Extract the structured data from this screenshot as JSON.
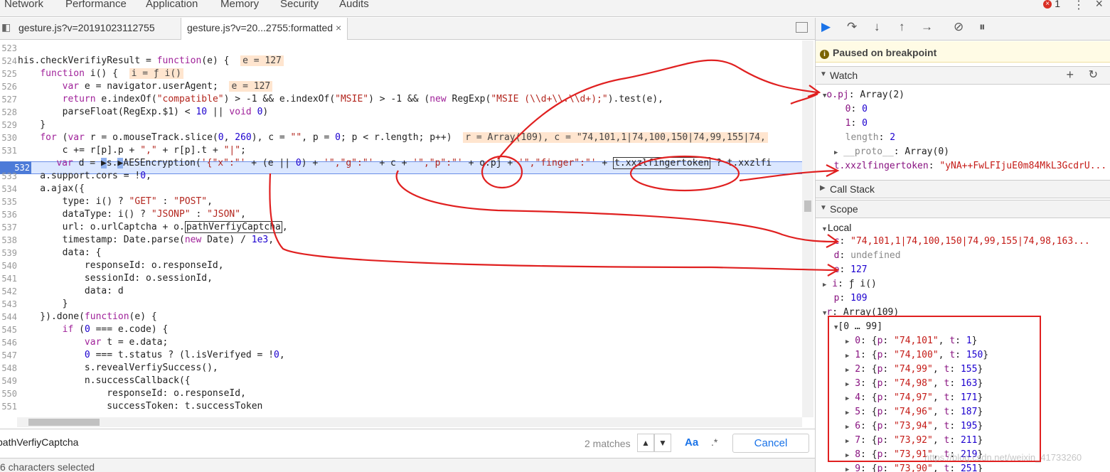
{
  "top_tabs": [
    "Network",
    "Performance",
    "Application",
    "Memory",
    "Security",
    "Audits"
  ],
  "error_count": "1",
  "file_tabs": [
    "gesture.js?v=20191023112755",
    "gesture.js?v=20...2755:formatted"
  ],
  "code_lines": [
    {
      "n": "523",
      "html": ""
    },
    {
      "n": "524",
      "html": "<span>his.checkVerifiyResult = </span><span class=\"kw\">function</span><span>(e) {  </span><span class=\"val\">e = 127</span>"
    },
    {
      "n": "525",
      "html": "<span>    </span><span class=\"kw\">function</span><span> i() {  </span><span class=\"val\">i = ƒ i()</span>"
    },
    {
      "n": "526",
      "html": "<span>        </span><span class=\"kw\">var</span><span> e = navigator.userAgent;  </span><span class=\"val\">e = 127</span>"
    },
    {
      "n": "527",
      "html": "<span>        </span><span class=\"kw\">return</span><span> e.indexOf(</span><span class=\"str\">\"compatible\"</span><span>) &gt; -1 &amp;&amp; e.indexOf(</span><span class=\"str\">\"MSIE\"</span><span>) &gt; -1 &amp;&amp; (</span><span class=\"kw\">new</span><span> RegExp(</span><span class=\"str\">\"MSIE (\\\\d+\\\\.\\\\d+);\"</span><span>).test(e),</span>"
    },
    {
      "n": "528",
      "html": "<span>        parseFloat(RegExp.$1) &lt; </span><span class=\"num\">10</span><span> || </span><span class=\"kw\">void</span><span> </span><span class=\"num\">0</span><span>)</span>"
    },
    {
      "n": "529",
      "html": "<span>    }</span>"
    },
    {
      "n": "530",
      "html": "<span>    </span><span class=\"kw\">for</span><span> (</span><span class=\"kw\">var</span><span> r = o.mouseTrack.slice(</span><span class=\"num\">0</span><span>, </span><span class=\"num\">260</span><span>), c = </span><span class=\"str\">\"\"</span><span>, p = </span><span class=\"num\">0</span><span>; p &lt; r.length; p++)  </span><span class=\"val\">r = Array(109), c = \"74,101,1|74,100,150|74,99,155|74,</span>"
    },
    {
      "n": "531",
      "html": "<span>        c += r[p].p + </span><span class=\"str\">\",\"</span><span> + r[p].t + </span><span class=\"str\">\"|\"</span><span>;</span>"
    },
    {
      "n": "532",
      "html": "<span>    </span><span class=\"kw\">var</span><span> d = </span><span style=\"background:#8fb0ee\">&#x25b6;</span><span>s.</span><span style=\"background:#8fb0ee\">&#x25b6;</span><span>AESEncryption(</span><span class=\"str\">'{\"x\":\"'</span><span> + (e || </span><span class=\"num\">0</span><span>) + </span><span class=\"str\">'\",\"g\":\"'</span><span> + c + </span><span class=\"str\">'\",\"p\":\"'</span><span> + o.pj + </span><span class=\"str\">'\",\"finger\":\"'</span><span> + </span><span class=\"hlbox\">t.xxzlfingertoken</span><span> ? t.xxzlfi</span>"
    },
    {
      "n": "533",
      "html": "<span>    a.support.cors = !</span><span class=\"num\">0</span><span>,</span>"
    },
    {
      "n": "534",
      "html": "<span>    a.ajax({</span>"
    },
    {
      "n": "535",
      "html": "<span>        type: i() ? </span><span class=\"str\">\"GET\"</span><span> : </span><span class=\"str\">\"POST\"</span><span>,</span>"
    },
    {
      "n": "536",
      "html": "<span>        dataType: i() ? </span><span class=\"str\">\"JSONP\"</span><span> : </span><span class=\"str\">\"JSON\"</span><span>,</span>"
    },
    {
      "n": "537",
      "html": "<span>        url: o.urlCaptcha + o.</span><span class=\"hlbox\">pathVerfiyCaptcha</span><span>,</span>"
    },
    {
      "n": "538",
      "html": "<span>        timestamp: Date.parse(</span><span class=\"kw\">new</span><span> Date) / </span><span class=\"num\">1e3</span><span>,</span>"
    },
    {
      "n": "539",
      "html": "<span>        data: {</span>"
    },
    {
      "n": "540",
      "html": "<span>            responseId: o.responseId,</span>"
    },
    {
      "n": "541",
      "html": "<span>            sessionId: o.sessionId,</span>"
    },
    {
      "n": "542",
      "html": "<span>            data: d</span>"
    },
    {
      "n": "543",
      "html": "<span>        }</span>"
    },
    {
      "n": "544",
      "html": "<span>    }).done(</span><span class=\"kw\">function</span><span>(e) {</span>"
    },
    {
      "n": "545",
      "html": "<span>        </span><span class=\"kw\">if</span><span> (</span><span class=\"num\">0</span><span> === e.code) {</span>"
    },
    {
      "n": "546",
      "html": "<span>            </span><span class=\"kw\">var</span><span> t = e.data;</span>"
    },
    {
      "n": "547",
      "html": "<span>            </span><span class=\"num\">0</span><span> === t.status ? (l.isVerifyed = !</span><span class=\"num\">0</span><span>,</span>"
    },
    {
      "n": "548",
      "html": "<span>            s.revealVerfiySuccess(),</span>"
    },
    {
      "n": "549",
      "html": "<span>            n.successCallback({</span>"
    },
    {
      "n": "550",
      "html": "<span>                responseId: o.responseId,</span>"
    },
    {
      "n": "551",
      "html": "<span>                successToken: t.successToken</span>"
    }
  ],
  "search": {
    "value": "pathVerfiyCaptcha",
    "matches": "2 matches",
    "case_label": "Aa",
    "regex_label": ".*",
    "cancel_label": "Cancel"
  },
  "status": "6 characters selected",
  "debugger": {
    "paused": "Paused on breakpoint",
    "watch_title": "Watch",
    "callstack_title": "Call Stack",
    "scope_title": "Scope",
    "local_title": "Local",
    "watch": [
      {
        "key": "o.pj",
        "val": "Array(2)",
        "indent": 0,
        "arrow": "down",
        "kind": "plain"
      },
      {
        "key": "0",
        "val": "0",
        "indent": 1,
        "arrow": "",
        "kind": "num"
      },
      {
        "key": "1",
        "val": "0",
        "indent": 1,
        "arrow": "",
        "kind": "num"
      },
      {
        "key": "length",
        "val": "2",
        "indent": 1,
        "arrow": "",
        "kind": "num",
        "dimkey": true
      },
      {
        "key": "__proto__",
        "val": "Array(0)",
        "indent": 1,
        "arrow": "right",
        "kind": "plain",
        "dimkey": true
      },
      {
        "key": "t.xxzlfingertoken",
        "val": "\"yNA++FwLFIjuE0m84MkL3GcdrU...",
        "indent": 0,
        "arrow": "",
        "kind": "str"
      }
    ],
    "local": [
      {
        "key": "c",
        "val": "\"74,101,1|74,100,150|74,99,155|74,98,163...",
        "indent": 0,
        "arrow": "",
        "kind": "str"
      },
      {
        "key": "d",
        "val": "undefined",
        "indent": 0,
        "arrow": "",
        "kind": "dim"
      },
      {
        "key": "e",
        "val": "127",
        "indent": 0,
        "arrow": "",
        "kind": "num"
      },
      {
        "key": "i",
        "val": "ƒ i()",
        "indent": 0,
        "arrow": "right",
        "kind": "plain"
      },
      {
        "key": "p",
        "val": "109",
        "indent": 0,
        "arrow": "",
        "kind": "num"
      },
      {
        "key": "r",
        "val": "Array(109)",
        "indent": 0,
        "arrow": "down",
        "kind": "plain"
      },
      {
        "key": "[0 … 99]",
        "val": "",
        "indent": 1,
        "arrow": "down",
        "kind": "group"
      },
      {
        "key": "0",
        "val": "{p: \"74,101\", t: 1}",
        "indent": 2,
        "arrow": "right",
        "kind": "obj",
        "p": "74,101",
        "t": "1"
      },
      {
        "key": "1",
        "val": "{p: \"74,100\", t: 150}",
        "indent": 2,
        "arrow": "right",
        "kind": "obj",
        "p": "74,100",
        "t": "150"
      },
      {
        "key": "2",
        "val": "{p: \"74,99\", t: 155}",
        "indent": 2,
        "arrow": "right",
        "kind": "obj",
        "p": "74,99",
        "t": "155"
      },
      {
        "key": "3",
        "val": "{p: \"74,98\", t: 163}",
        "indent": 2,
        "arrow": "right",
        "kind": "obj",
        "p": "74,98",
        "t": "163"
      },
      {
        "key": "4",
        "val": "{p: \"74,97\", t: 171}",
        "indent": 2,
        "arrow": "right",
        "kind": "obj",
        "p": "74,97",
        "t": "171"
      },
      {
        "key": "5",
        "val": "{p: \"74,96\", t: 187}",
        "indent": 2,
        "arrow": "right",
        "kind": "obj",
        "p": "74,96",
        "t": "187"
      },
      {
        "key": "6",
        "val": "{p: \"73,94\", t: 195}",
        "indent": 2,
        "arrow": "right",
        "kind": "obj",
        "p": "73,94",
        "t": "195"
      },
      {
        "key": "7",
        "val": "{p: \"73,92\", t: 211}",
        "indent": 2,
        "arrow": "right",
        "kind": "obj",
        "p": "73,92",
        "t": "211"
      },
      {
        "key": "8",
        "val": "{p: \"73,91\", t: 219}",
        "indent": 2,
        "arrow": "right",
        "kind": "obj",
        "p": "73,91",
        "t": "219"
      },
      {
        "key": "9",
        "val": "{p: \"73,90\", t: 251}",
        "indent": 2,
        "arrow": "right",
        "kind": "obj",
        "p": "73,90",
        "t": "251"
      }
    ]
  },
  "watermark": "https://blog.csdn.net/weixin_41733260",
  "colors": {
    "annotation": "#e02020",
    "breakpoint": "#4d7bd8",
    "paused_bg": "#fffbe5"
  }
}
